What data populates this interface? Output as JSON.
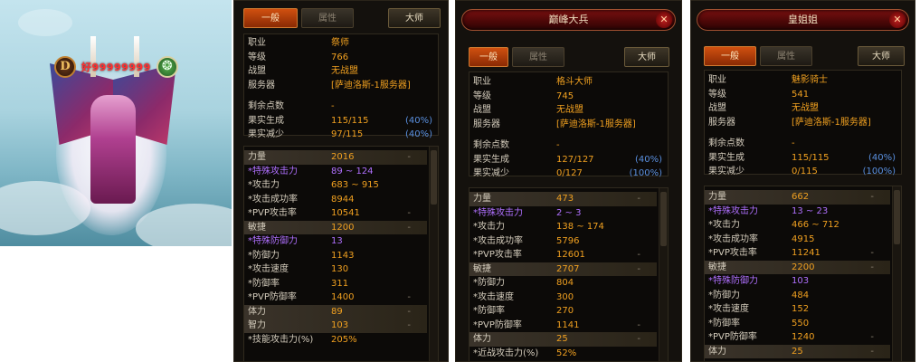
{
  "scene": {
    "badge_letter": "D",
    "player_name": "好99999999",
    "icons": [
      "d-rank-badge-icon",
      "swirl-emblem-icon"
    ],
    "colors": {
      "name": "#ff3030",
      "snow": "#c4e4ee"
    }
  },
  "panels": [
    {
      "title": "",
      "tabs": {
        "general": "一般",
        "attributes": "属性",
        "master": "大师"
      },
      "info": [
        {
          "label": "职业",
          "value": "祭师",
          "pct": ""
        },
        {
          "label": "等级",
          "value": "766",
          "pct": ""
        },
        {
          "label": "战盟",
          "value": "无战盟",
          "pct": ""
        },
        {
          "label": "服务器",
          "value": "[萨迪洛斯-1服务器]",
          "pct": ""
        },
        {
          "label": "剩余点数",
          "value": "-",
          "pct": ""
        },
        {
          "label": "果实生成",
          "value": "115/115",
          "pct": "(40%)"
        },
        {
          "label": "果实减少",
          "value": "97/115",
          "pct": "(40%)"
        }
      ],
      "stats": [
        {
          "label": "力量",
          "value": "2016",
          "dash": "-",
          "type": "major"
        },
        {
          "label": "*特殊攻击力",
          "value": "89 ~ 124",
          "dash": "",
          "type": "special"
        },
        {
          "label": "*攻击力",
          "value": "683 ~ 915",
          "dash": "",
          "type": "normal"
        },
        {
          "label": "*攻击成功率",
          "value": "8944",
          "dash": "",
          "type": "normal"
        },
        {
          "label": "*PVP攻击率",
          "value": "10541",
          "dash": "-",
          "type": "normal"
        },
        {
          "label": "敏捷",
          "value": "1200",
          "dash": "-",
          "type": "major"
        },
        {
          "label": "*特殊防御力",
          "value": "13",
          "dash": "",
          "type": "special"
        },
        {
          "label": "*防御力",
          "value": "1143",
          "dash": "",
          "type": "normal"
        },
        {
          "label": "*攻击速度",
          "value": "130",
          "dash": "",
          "type": "normal"
        },
        {
          "label": "*防御率",
          "value": "311",
          "dash": "",
          "type": "normal"
        },
        {
          "label": "*PVP防御率",
          "value": "1400",
          "dash": "-",
          "type": "normal"
        },
        {
          "label": "体力",
          "value": "89",
          "dash": "-",
          "type": "major"
        },
        {
          "label": "智力",
          "value": "103",
          "dash": "-",
          "type": "major"
        },
        {
          "label": "*技能攻击力(%)",
          "value": "205%",
          "dash": "",
          "type": "normal"
        }
      ]
    },
    {
      "title": "巅峰大兵",
      "tabs": {
        "general": "一般",
        "attributes": "属性",
        "master": "大师"
      },
      "info": [
        {
          "label": "职业",
          "value": "格斗大师",
          "pct": ""
        },
        {
          "label": "等级",
          "value": "745",
          "pct": ""
        },
        {
          "label": "战盟",
          "value": "无战盟",
          "pct": ""
        },
        {
          "label": "服务器",
          "value": "[萨迪洛斯-1服务器]",
          "pct": ""
        },
        {
          "label": "剩余点数",
          "value": "-",
          "pct": ""
        },
        {
          "label": "果实生成",
          "value": "127/127",
          "pct": "(40%)"
        },
        {
          "label": "果实减少",
          "value": "0/127",
          "pct": "(100%)"
        }
      ],
      "stats": [
        {
          "label": "力量",
          "value": "473",
          "dash": "-",
          "type": "major"
        },
        {
          "label": "*特殊攻击力",
          "value": "2 ~ 3",
          "dash": "",
          "type": "special"
        },
        {
          "label": "*攻击力",
          "value": "138 ~ 174",
          "dash": "",
          "type": "normal"
        },
        {
          "label": "*攻击成功率",
          "value": "5796",
          "dash": "",
          "type": "normal"
        },
        {
          "label": "*PVP攻击率",
          "value": "12601",
          "dash": "-",
          "type": "normal"
        },
        {
          "label": "敏捷",
          "value": "2707",
          "dash": "-",
          "type": "major"
        },
        {
          "label": "*防御力",
          "value": "804",
          "dash": "",
          "type": "normal"
        },
        {
          "label": "*攻击速度",
          "value": "300",
          "dash": "",
          "type": "normal"
        },
        {
          "label": "*防御率",
          "value": "270",
          "dash": "",
          "type": "normal"
        },
        {
          "label": "*PVP防御率",
          "value": "1141",
          "dash": "-",
          "type": "normal"
        },
        {
          "label": "体力",
          "value": "25",
          "dash": "-",
          "type": "major"
        },
        {
          "label": "*近战攻击力(%)",
          "value": "52%",
          "dash": "",
          "type": "normal"
        }
      ]
    },
    {
      "title": "皇姐姐",
      "tabs": {
        "general": "一般",
        "attributes": "属性",
        "master": "大师"
      },
      "info": [
        {
          "label": "职业",
          "value": "魅影骑士",
          "pct": ""
        },
        {
          "label": "等级",
          "value": "541",
          "pct": ""
        },
        {
          "label": "战盟",
          "value": "无战盟",
          "pct": ""
        },
        {
          "label": "服务器",
          "value": "[萨迪洛斯-1服务器]",
          "pct": ""
        },
        {
          "label": "剩余点数",
          "value": "-",
          "pct": ""
        },
        {
          "label": "果实生成",
          "value": "115/115",
          "pct": "(40%)"
        },
        {
          "label": "果实减少",
          "value": "0/115",
          "pct": "(100%)"
        }
      ],
      "stats": [
        {
          "label": "力量",
          "value": "662",
          "dash": "-",
          "type": "major"
        },
        {
          "label": "*特殊攻击力",
          "value": "13 ~ 23",
          "dash": "",
          "type": "special"
        },
        {
          "label": "*攻击力",
          "value": "466 ~ 712",
          "dash": "",
          "type": "normal"
        },
        {
          "label": "*攻击成功率",
          "value": "4915",
          "dash": "",
          "type": "normal"
        },
        {
          "label": "*PVP攻击率",
          "value": "11241",
          "dash": "-",
          "type": "normal"
        },
        {
          "label": "敏捷",
          "value": "2200",
          "dash": "-",
          "type": "major"
        },
        {
          "label": "*特殊防御力",
          "value": "103",
          "dash": "",
          "type": "special"
        },
        {
          "label": "*防御力",
          "value": "484",
          "dash": "",
          "type": "normal"
        },
        {
          "label": "*攻击速度",
          "value": "152",
          "dash": "",
          "type": "normal"
        },
        {
          "label": "*防御率",
          "value": "550",
          "dash": "",
          "type": "normal"
        },
        {
          "label": "*PVP防御率",
          "value": "1240",
          "dash": "-",
          "type": "normal"
        },
        {
          "label": "体力",
          "value": "25",
          "dash": "-",
          "type": "major"
        }
      ]
    }
  ]
}
